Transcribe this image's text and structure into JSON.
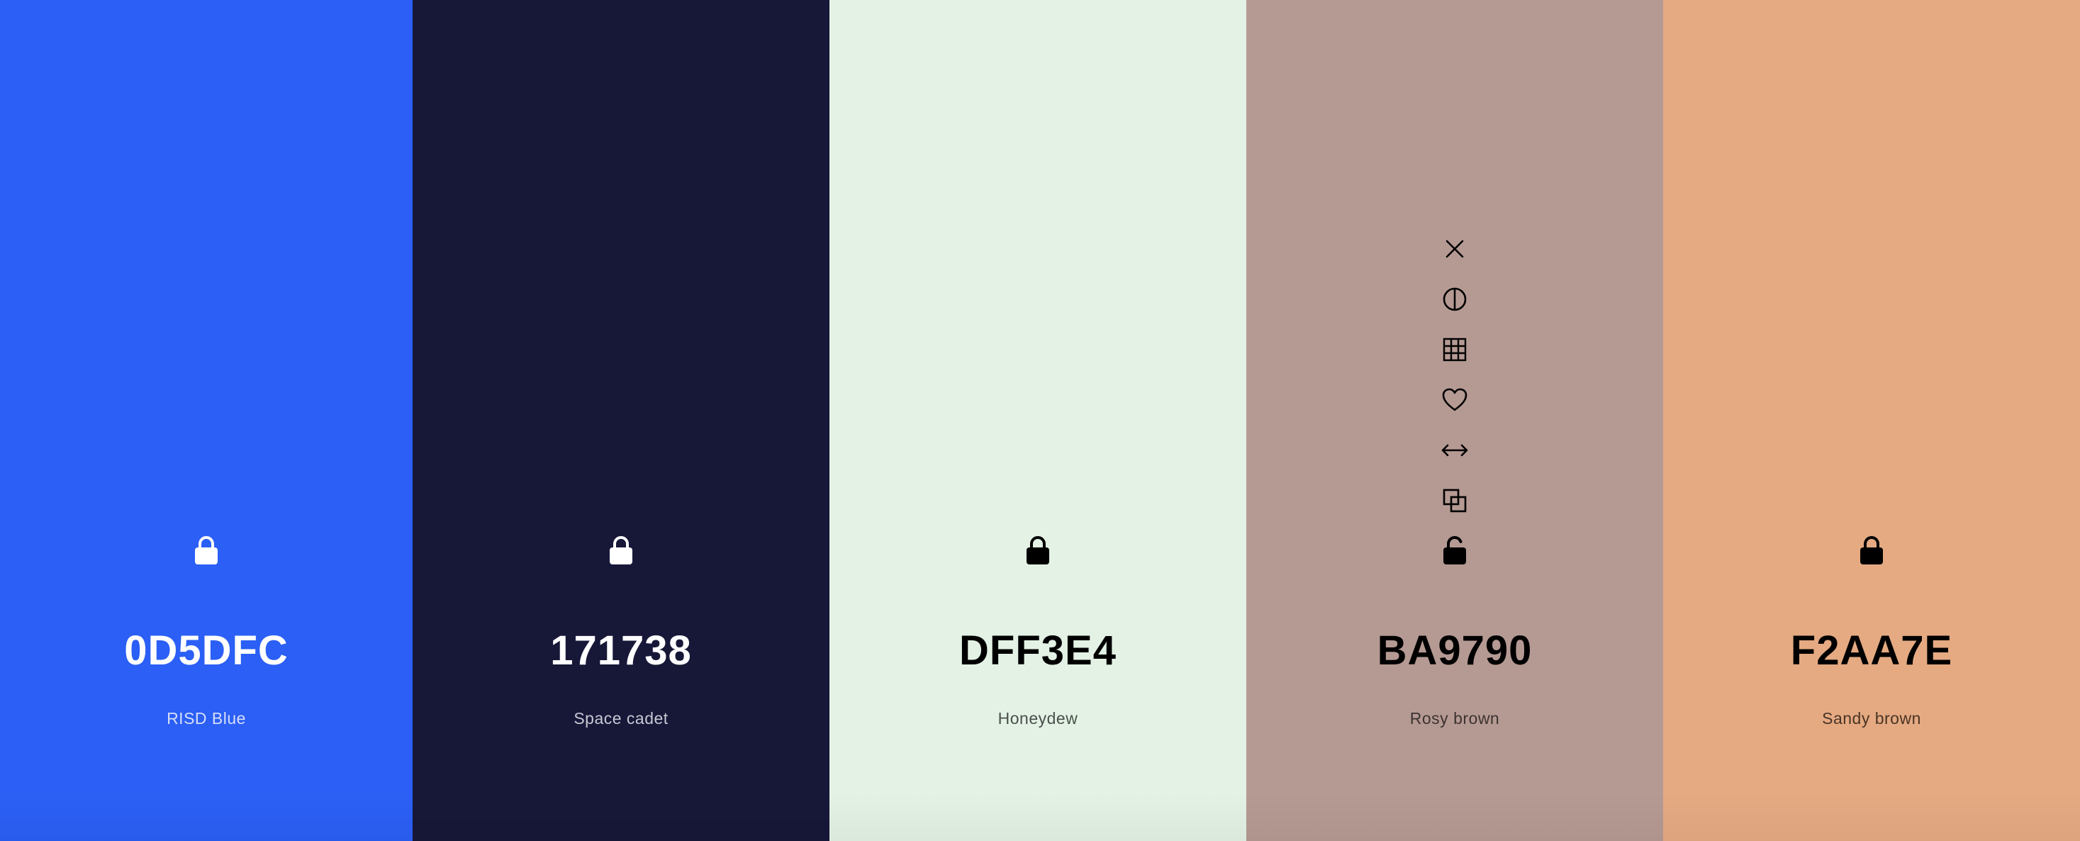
{
  "palette": [
    {
      "hex": "0D5DFC",
      "name": "RISD Blue",
      "background": "#2B5FF5",
      "text_color": "#FFFFFF",
      "name_color": "#D6DEFA",
      "locked": true,
      "lock_icon": "lock-closed-icon"
    },
    {
      "hex": "171738",
      "name": "Space cadet",
      "background": "#171738",
      "text_color": "#FFFFFF",
      "name_color": "#C8C8D4",
      "locked": true,
      "lock_icon": "lock-closed-icon"
    },
    {
      "hex": "DFF3E4",
      "name": "Honeydew",
      "background": "#E3F2E5",
      "text_color": "#000000",
      "name_color": "#4A4F4B",
      "locked": true,
      "lock_icon": "lock-closed-icon"
    },
    {
      "hex": "BA9790",
      "name": "Rosy brown",
      "background": "#B59A93",
      "text_color": "#000000",
      "name_color": "#3D3331",
      "locked": false,
      "lock_icon": "lock-open-icon",
      "hovered": true,
      "tools": [
        {
          "icon": "close-icon",
          "action": "remove"
        },
        {
          "icon": "contrast-icon",
          "action": "view-shades"
        },
        {
          "icon": "grid-icon",
          "action": "shades-grid"
        },
        {
          "icon": "heart-icon",
          "action": "save-color"
        },
        {
          "icon": "drag-arrows-icon",
          "action": "drag"
        },
        {
          "icon": "copy-icon",
          "action": "copy-hex"
        }
      ]
    },
    {
      "hex": "F2AA7E",
      "name": "Sandy brown",
      "background": "#E5AA82",
      "text_color": "#000000",
      "name_color": "#4A3426",
      "locked": true,
      "lock_icon": "lock-closed-icon"
    }
  ]
}
